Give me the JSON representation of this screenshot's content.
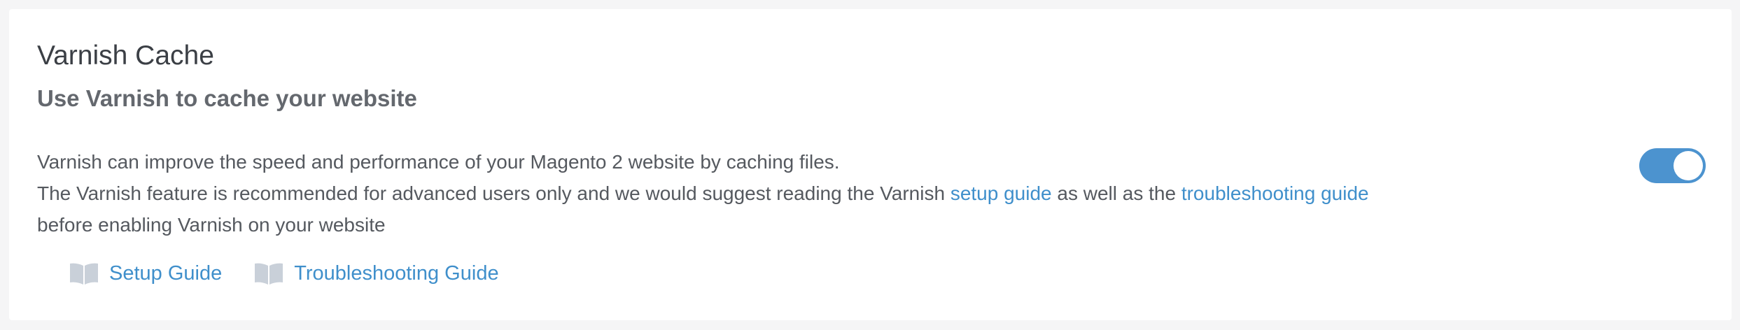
{
  "card": {
    "title": "Varnish Cache",
    "subtitle": "Use Varnish to cache your website",
    "description": {
      "line1": "Varnish can improve the speed and performance of your Magento 2 website by caching files.",
      "line2_prefix": "The Varnish feature is recommended for advanced users only and we would suggest reading the Varnish ",
      "setup_guide_link": "setup guide",
      "line2_middle": " as well as the ",
      "troubleshooting_guide_link": "troubleshooting guide",
      "line3": "before enabling Varnish on your website"
    },
    "toggle": {
      "state": "on",
      "color": "#4c93cf"
    },
    "guides": [
      {
        "label": "Setup Guide",
        "icon": "book-icon"
      },
      {
        "label": "Troubleshooting Guide",
        "icon": "book-icon"
      }
    ]
  },
  "colors": {
    "link": "#3f8fcb",
    "title": "#3b3f45",
    "text": "#55595f",
    "icon": "#c9d0d9"
  }
}
